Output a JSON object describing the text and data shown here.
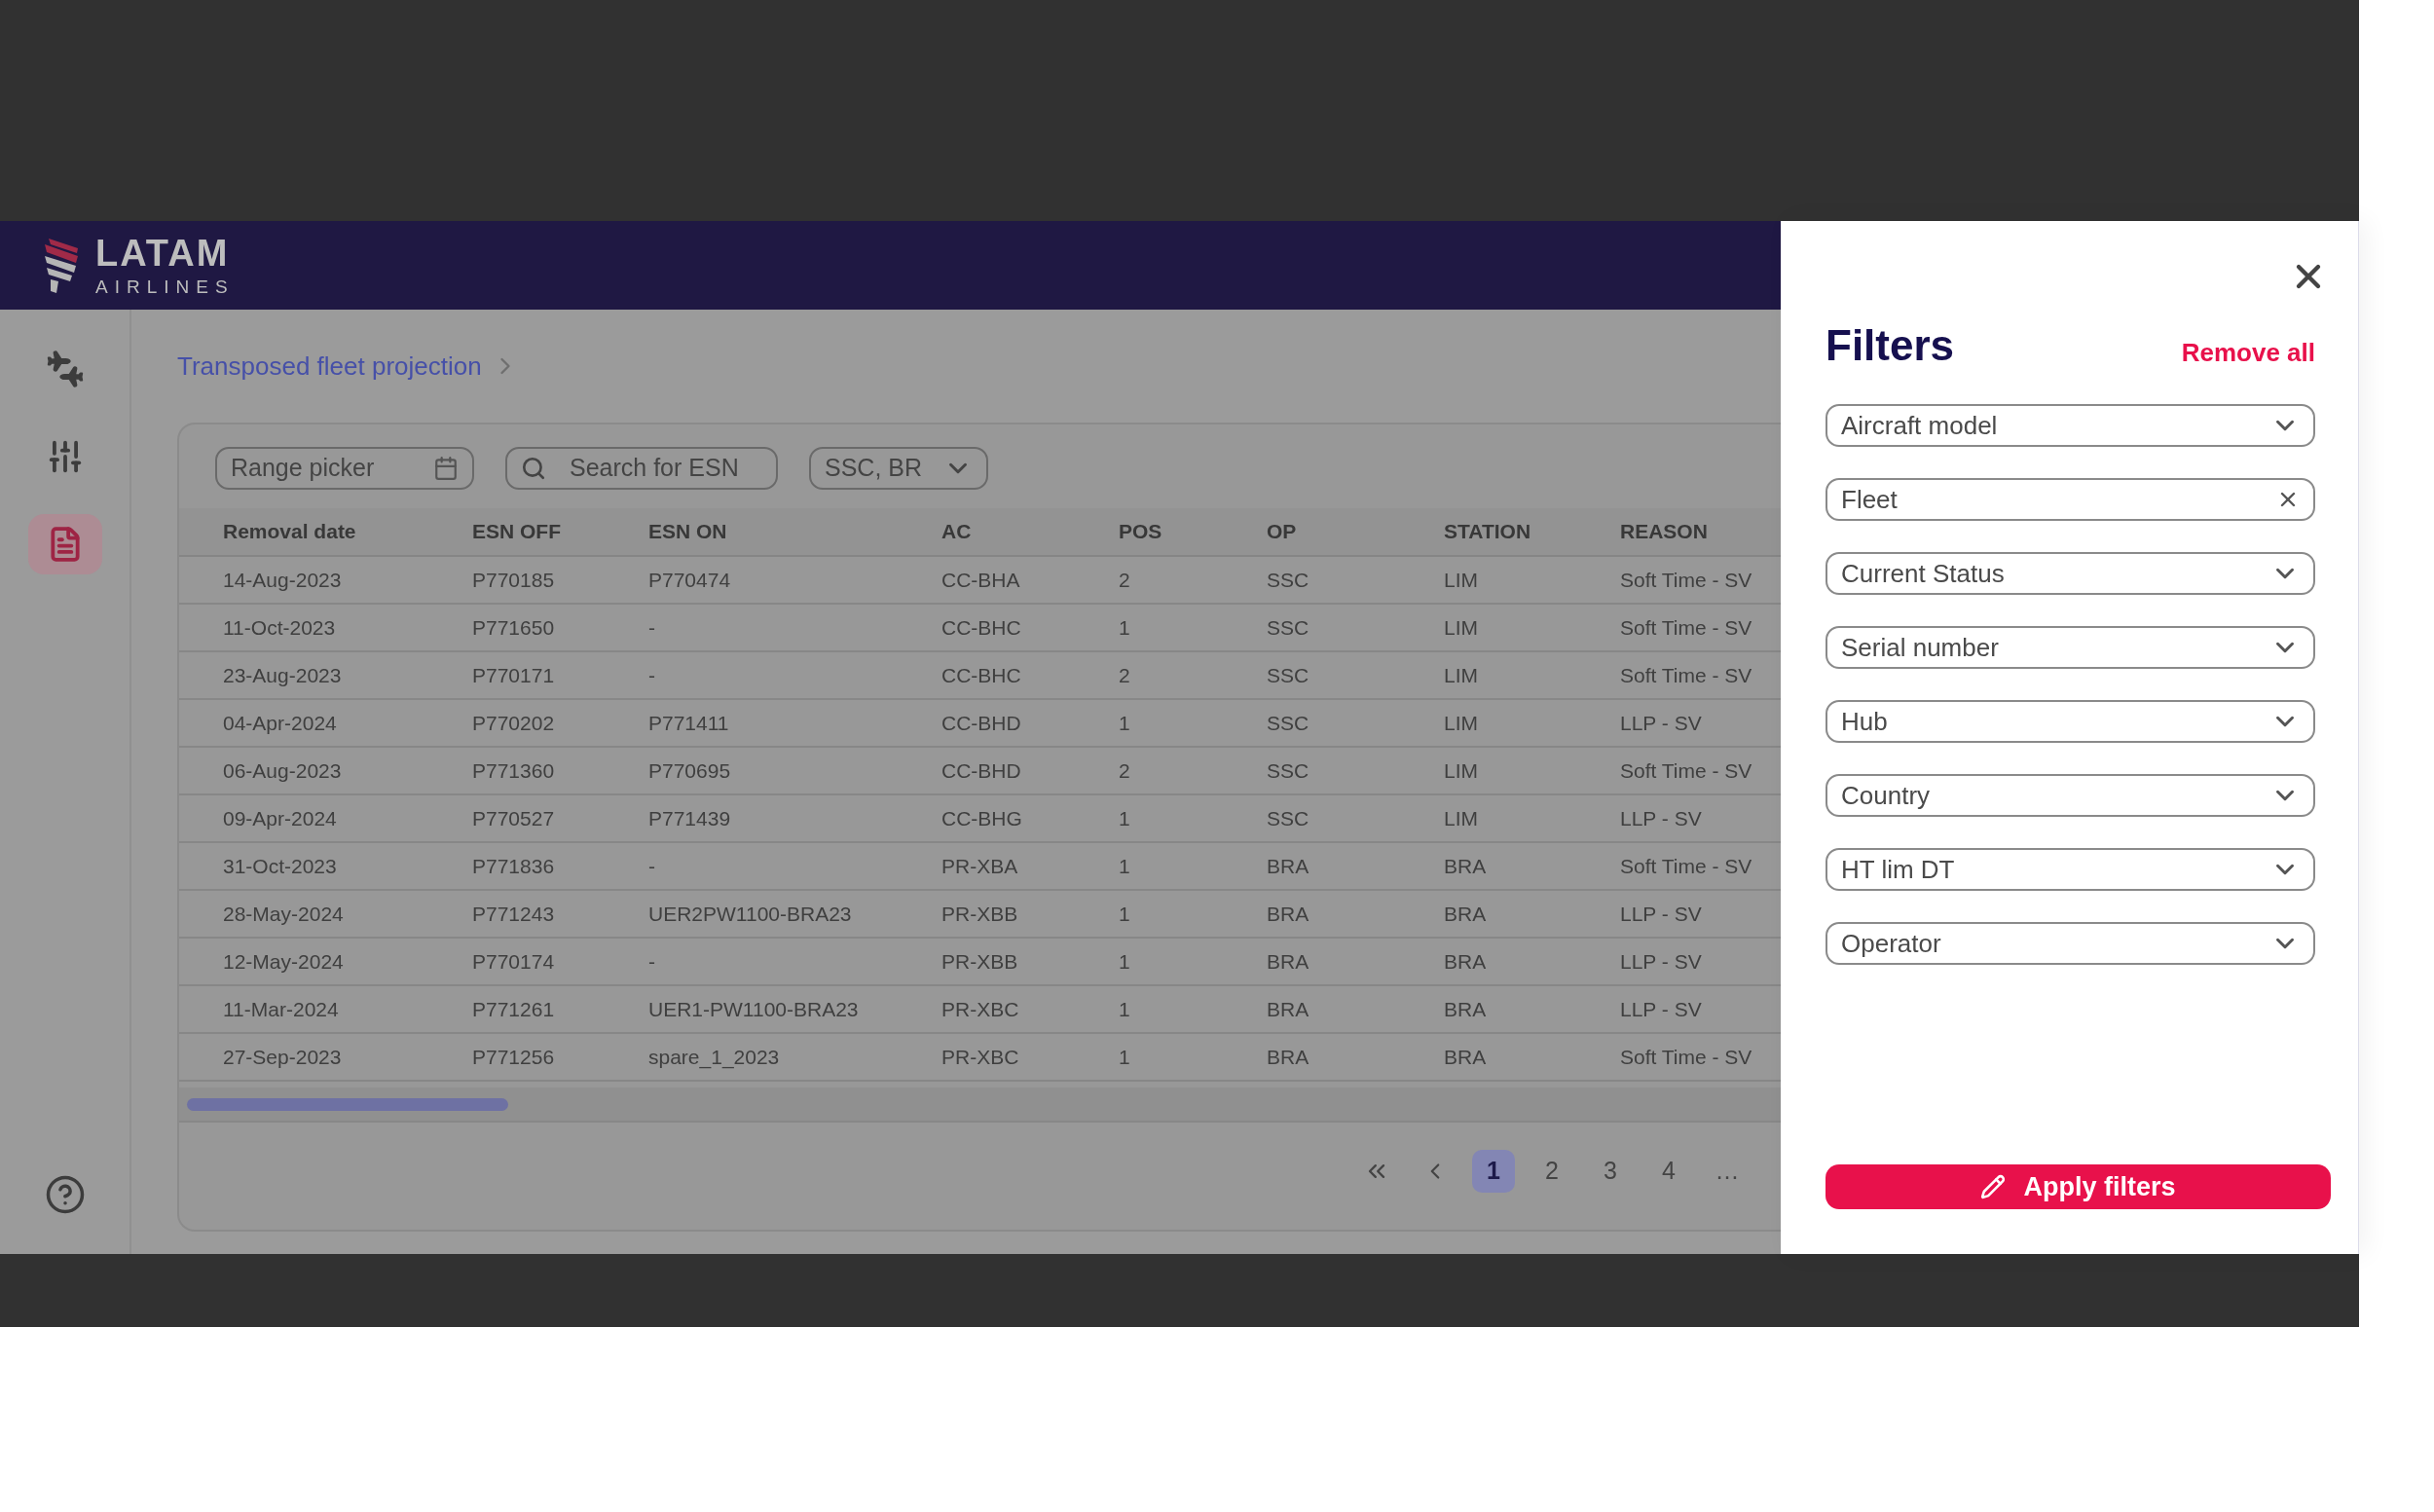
{
  "header": {
    "logo_text": "LATAM",
    "logo_subtext": "AIRLINES"
  },
  "sidebar": {
    "items": [
      {
        "kind": "fleet",
        "selected": false
      },
      {
        "kind": "adjust",
        "selected": false
      },
      {
        "kind": "report",
        "selected": true
      }
    ]
  },
  "breadcrumb": [
    "Transposed fleet projection"
  ],
  "toolbar": {
    "range_picker": {
      "placeholder": "Range picker"
    },
    "search": {
      "placeholder": "Search for ESN"
    },
    "operator_select": {
      "value": "SSC, BR"
    }
  },
  "table": {
    "columns": [
      "Removal date",
      "ESN OFF",
      "ESN ON",
      "AC",
      "POS",
      "OP",
      "STATION",
      "REASON"
    ],
    "rows": [
      [
        "14-Aug-2023",
        "P770185",
        "P770474",
        "CC-BHA",
        "2",
        "SSC",
        "LIM",
        "Soft Time - SV"
      ],
      [
        "11-Oct-2023",
        "P771650",
        "-",
        "CC-BHC",
        "1",
        "SSC",
        "LIM",
        "Soft Time - SV"
      ],
      [
        "23-Aug-2023",
        "P770171",
        "-",
        "CC-BHC",
        "2",
        "SSC",
        "LIM",
        "Soft Time - SV"
      ],
      [
        "04-Apr-2024",
        "P770202",
        "P771411",
        "CC-BHD",
        "1",
        "SSC",
        "LIM",
        "LLP - SV"
      ],
      [
        "06-Aug-2023",
        "P771360",
        "P770695",
        "CC-BHD",
        "2",
        "SSC",
        "LIM",
        "Soft Time - SV"
      ],
      [
        "09-Apr-2024",
        "P770527",
        "P771439",
        "CC-BHG",
        "1",
        "SSC",
        "LIM",
        "LLP - SV"
      ],
      [
        "31-Oct-2023",
        "P771836",
        "-",
        "PR-XBA",
        "1",
        "BRA",
        "BRA",
        "Soft Time - SV"
      ],
      [
        "28-May-2024",
        "P771243",
        "UER2PW1100-BRA23",
        "PR-XBB",
        "1",
        "BRA",
        "BRA",
        "LLP - SV"
      ],
      [
        "12-May-2024",
        "P770174",
        "-",
        "PR-XBB",
        "1",
        "BRA",
        "BRA",
        "LLP - SV"
      ],
      [
        "11-Mar-2024",
        "P771261",
        "UER1-PW1100-BRA23",
        "PR-XBC",
        "1",
        "BRA",
        "BRA",
        "LLP - SV"
      ],
      [
        "27-Sep-2023",
        "P771256",
        "spare_1_2023",
        "PR-XBC",
        "1",
        "BRA",
        "BRA",
        "Soft Time - SV"
      ]
    ]
  },
  "pagination": {
    "pages": [
      {
        "label": "1",
        "selected": true
      },
      {
        "label": "2",
        "selected": false
      },
      {
        "label": "3",
        "selected": false
      },
      {
        "label": "4",
        "selected": false
      }
    ],
    "ellipsis": "…"
  },
  "filters_panel": {
    "title": "Filters",
    "remove_all": "Remove all",
    "fields": [
      {
        "label": "Aircraft model",
        "kind": "select"
      },
      {
        "label": "Fleet",
        "kind": "clearable"
      },
      {
        "label": "Current Status",
        "kind": "select"
      },
      {
        "label": "Serial number",
        "kind": "select"
      },
      {
        "label": "Hub",
        "kind": "select"
      },
      {
        "label": "Country",
        "kind": "select"
      },
      {
        "label": "HT lim DT",
        "kind": "select"
      },
      {
        "label": "Operator",
        "kind": "select"
      }
    ],
    "apply_button": "Apply filters"
  }
}
